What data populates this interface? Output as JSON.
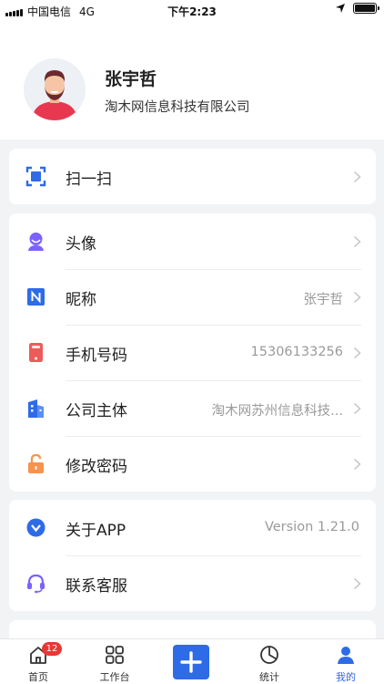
{
  "status_bar": {
    "carrier": "中国电信",
    "network": "4G",
    "time": "下午2:23"
  },
  "profile": {
    "name": "张宇哲",
    "company": "淘木网信息科技有限公司"
  },
  "scan": {
    "label": "扫一扫",
    "icon": "scan-icon"
  },
  "settings": {
    "avatar": {
      "label": "头像",
      "icon": "user-avatar-icon"
    },
    "nickname": {
      "label": "昵称",
      "value": "张宇哲",
      "icon": "nickname-n-icon"
    },
    "phone": {
      "label": "手机号码",
      "value": "15306133256",
      "icon": "phone-icon"
    },
    "company": {
      "label": "公司主体",
      "value": "淘木网苏州信息科技...",
      "icon": "building-icon"
    },
    "password": {
      "label": "修改密码",
      "icon": "lock-icon"
    }
  },
  "about": {
    "app": {
      "label": "关于APP",
      "value": "Version 1.21.0",
      "icon": "version-check-icon"
    },
    "support": {
      "label": "联系客服",
      "icon": "headset-icon"
    }
  },
  "tabbar": {
    "home": {
      "label": "首页",
      "badge": "12"
    },
    "workbench": {
      "label": "工作台"
    },
    "add": {
      "icon": "plus-icon"
    },
    "stats": {
      "label": "统计"
    },
    "mine": {
      "label": "我的",
      "active": true
    }
  },
  "colors": {
    "accent": "#2e6be6",
    "avatar_purple": "#7b61ff",
    "phone_red": "#ef5a5a",
    "lock_orange": "#f7934c",
    "badge_red": "#e53935"
  }
}
